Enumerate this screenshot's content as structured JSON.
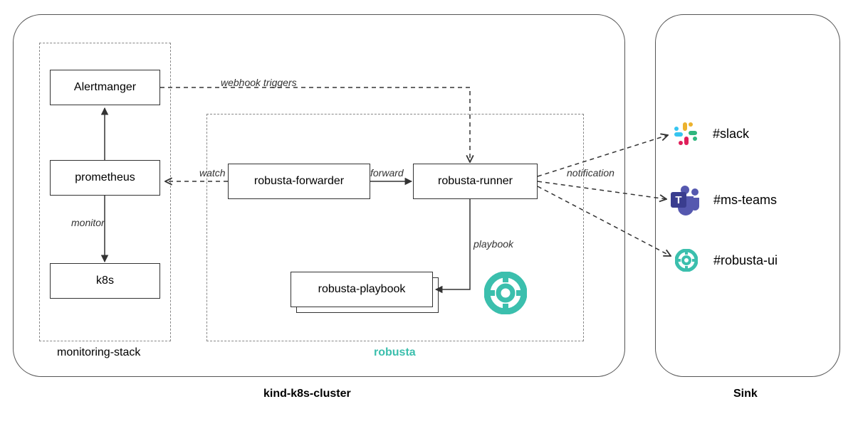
{
  "cluster": {
    "label": "kind-k8s-cluster",
    "monitoring": {
      "label": "monitoring-stack",
      "nodes": {
        "alertmanager": "Alertmanger",
        "prometheus": "prometheus",
        "k8s": "k8s"
      }
    },
    "robusta": {
      "label": "robusta",
      "nodes": {
        "forwarder": "robusta-forwarder",
        "runner": "robusta-runner",
        "playbook": "robusta-playbook"
      }
    }
  },
  "sink": {
    "label": "Sink",
    "items": {
      "slack": "#slack",
      "teams": "#ms-teams",
      "robusta_ui": "#robusta-ui"
    }
  },
  "edges": {
    "webhook": "webhook triggers",
    "watch": "watch",
    "forward": "forward",
    "monitor": "monitor",
    "playbook": "playbook",
    "notification": "notification"
  },
  "colors": {
    "robusta_teal": "#3bbfad",
    "teams_purple": "#5558af",
    "slack_red": "#e01e5a",
    "slack_yellow": "#ecb22e",
    "slack_green": "#2eb67d",
    "slack_blue": "#36c5f0"
  }
}
